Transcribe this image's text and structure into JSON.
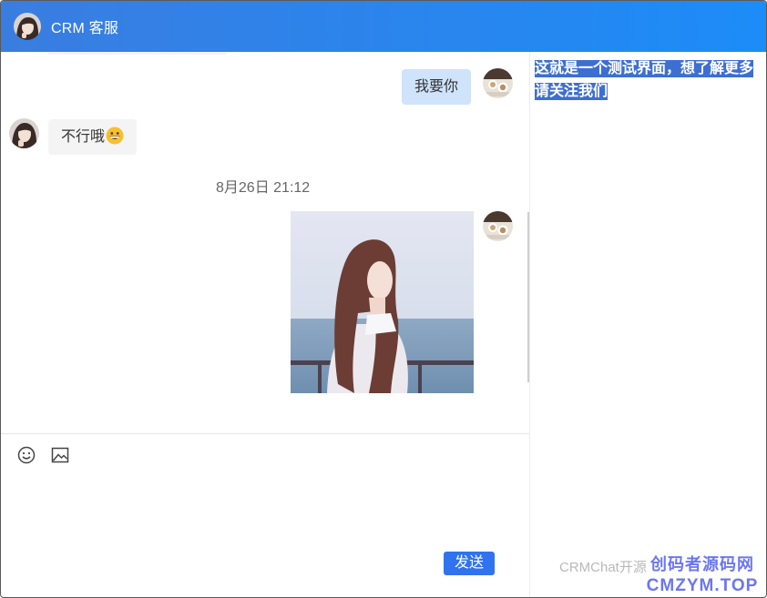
{
  "header": {
    "title": "CRM 客服",
    "avatar_icon": "user-avatar-icon"
  },
  "chat": {
    "messages": [
      {
        "side": "self",
        "type": "text",
        "text": "我要你"
      },
      {
        "side": "other",
        "type": "text",
        "text": "不行哦",
        "emoji": "grinning-face"
      },
      {
        "type": "time",
        "text": "8月26日 21:12"
      },
      {
        "side": "self",
        "type": "image",
        "image_icon": "girl-photo-image"
      }
    ]
  },
  "toolbar": {
    "emoji_icon": "smiley-icon",
    "image_icon": "picture-icon"
  },
  "compose": {
    "value": "",
    "placeholder": ""
  },
  "send_label": "发送",
  "notice": {
    "text": "这就是一个测试界面，想了解更多请关注我们"
  },
  "footer": {
    "brand": "CRMChat开源"
  },
  "watermark": {
    "line1": "创码者源码网",
    "line2": "CMZYM.TOP"
  },
  "colors": {
    "header_start": "#3a7de0",
    "header_end": "#1c8cf8",
    "self_bubble": "#cfe3fb",
    "other_bubble": "#f4f4f4",
    "send_button": "#2f73f0",
    "notice_highlight": "#3d6fd2",
    "watermark": "#6b76f2"
  }
}
